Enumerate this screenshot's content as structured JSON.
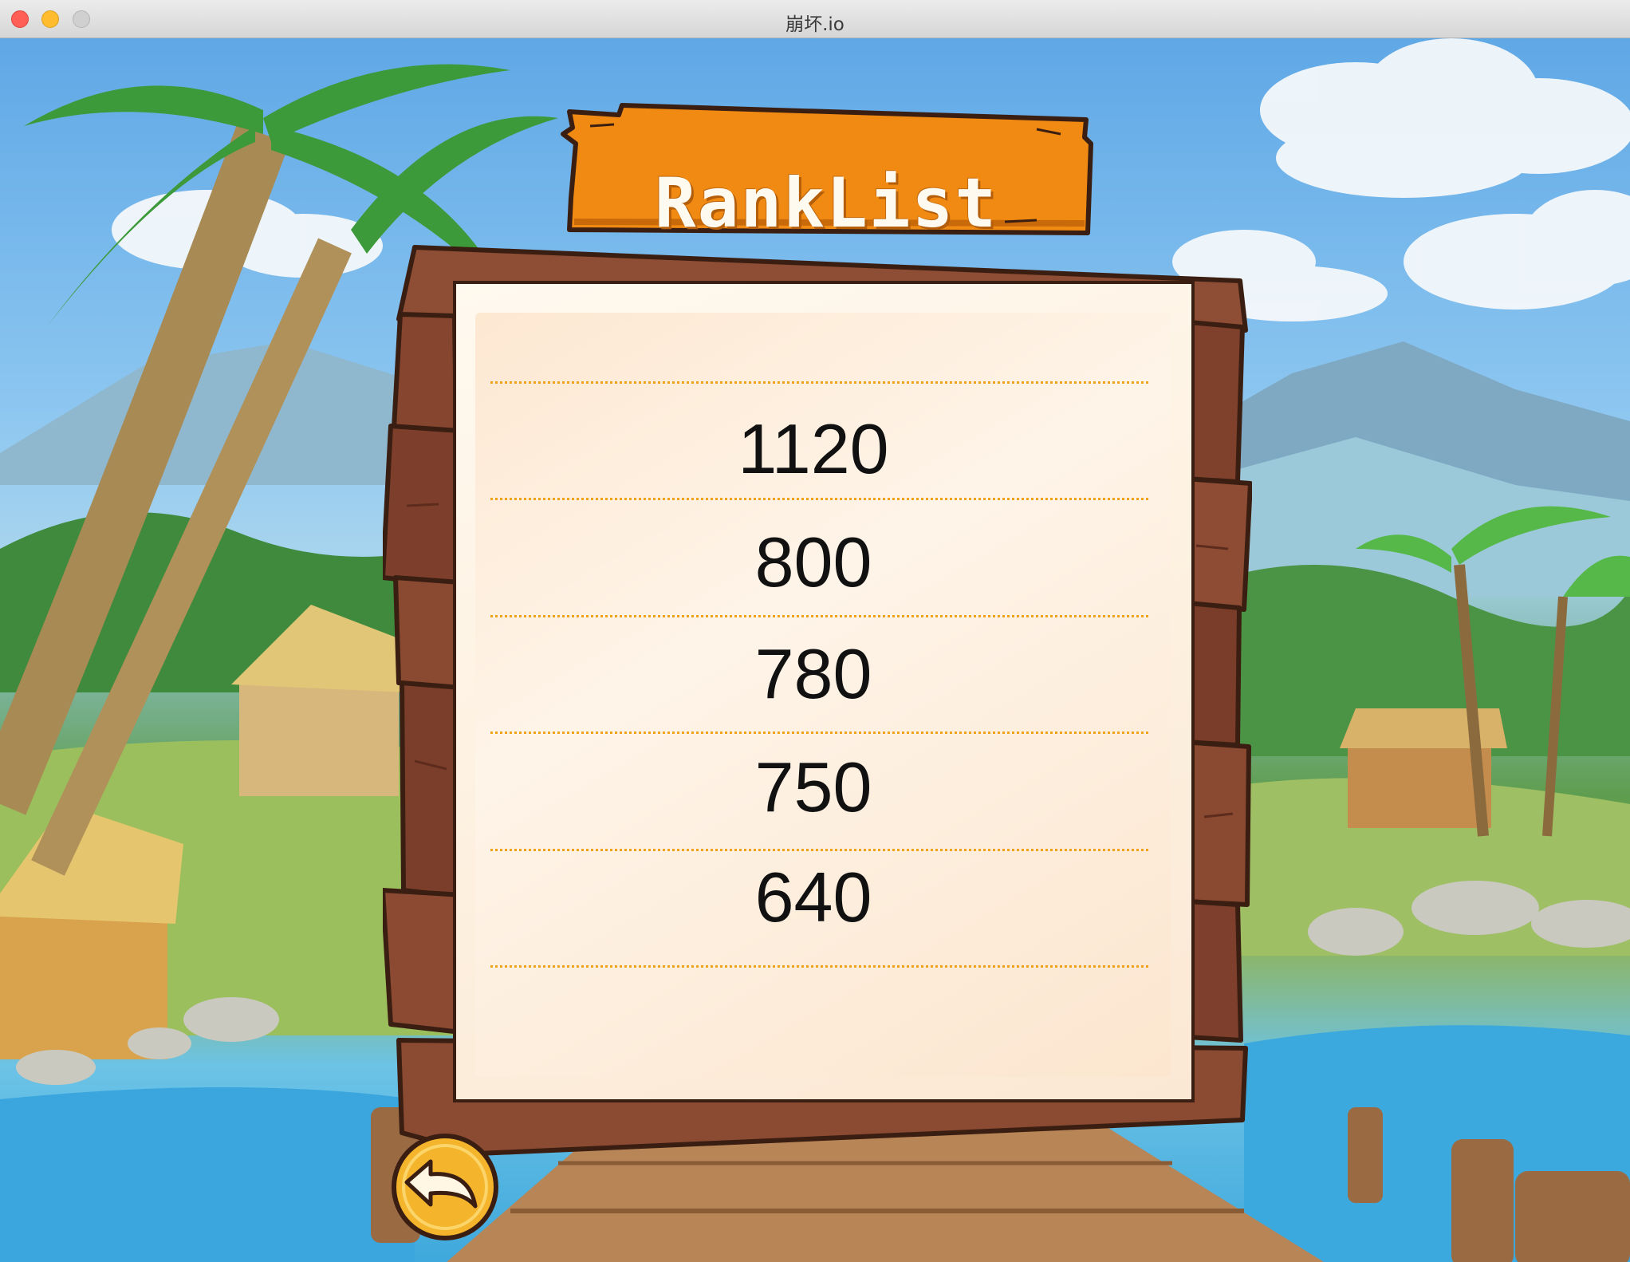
{
  "window": {
    "title": "崩坏.io"
  },
  "ranklist": {
    "title": "RankList",
    "scores": [
      "1120",
      "800",
      "780",
      "750",
      "640"
    ]
  },
  "icons": {
    "back": "back-arrow-icon"
  },
  "colors": {
    "sign_orange": "#f08a12",
    "wood_brown": "#8a4a33",
    "paper": "#fdf0df",
    "rule_dots": "#f0a21b",
    "back_button": "#f4b52c"
  }
}
